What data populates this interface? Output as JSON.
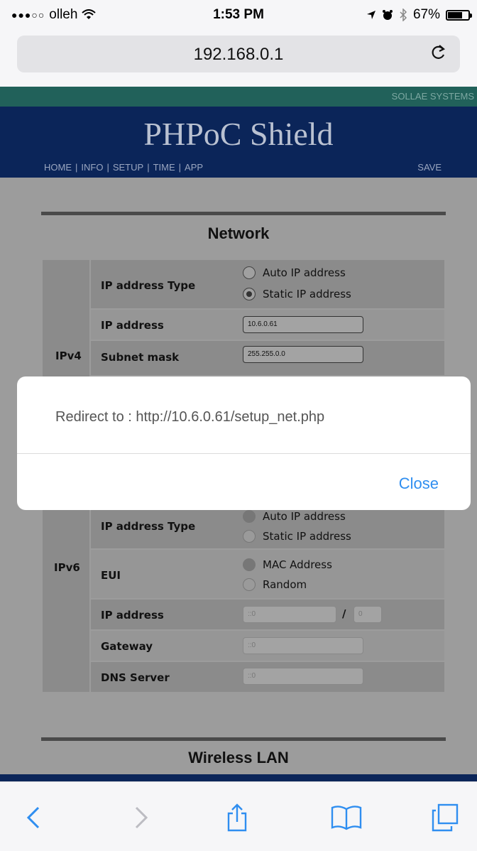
{
  "status_bar": {
    "carrier": "olleh",
    "time": "1:53 PM",
    "battery_percent": "67%"
  },
  "browser": {
    "url": "192.168.0.1"
  },
  "page": {
    "brand": "SOLLAE SYSTEMS",
    "title": "PHPoC Shield",
    "nav": [
      "HOME",
      "|",
      "INFO",
      "|",
      "SETUP",
      "|",
      "TIME",
      "|",
      "APP"
    ],
    "save": "SAVE",
    "network_title": "Network",
    "wireless_title": "Wireless LAN",
    "ipv4": {
      "group_label": "IPv4",
      "ip_type_label": "IP address Type",
      "option_auto": "Auto IP address",
      "option_static": "Static IP address",
      "selected": "static",
      "ip_label": "IP address",
      "ip_value": "10.6.0.61",
      "subnet_label": "Subnet mask",
      "subnet_value": "255.255.0.0"
    },
    "ipv6": {
      "group_label": "IPv6",
      "ip_type_label": "IP address Type",
      "option_auto": "Auto IP address",
      "option_static": "Static IP address",
      "eui_label": "EUI",
      "eui_mac": "MAC Address",
      "eui_random": "Random",
      "ip_label": "IP address",
      "ip_value": "::0",
      "prefix_sep": "/",
      "prefix_value": "0",
      "gateway_label": "Gateway",
      "gateway_value": "::0",
      "dns_label": "DNS Server",
      "dns_value": "::0"
    }
  },
  "dialog": {
    "message": "Redirect to : http://10.6.0.61/setup_net.php",
    "close_label": "Close"
  },
  "colors": {
    "header_bg": "#0b2559",
    "brand_strip": "#21615a",
    "link_blue": "#2f8ef0"
  }
}
